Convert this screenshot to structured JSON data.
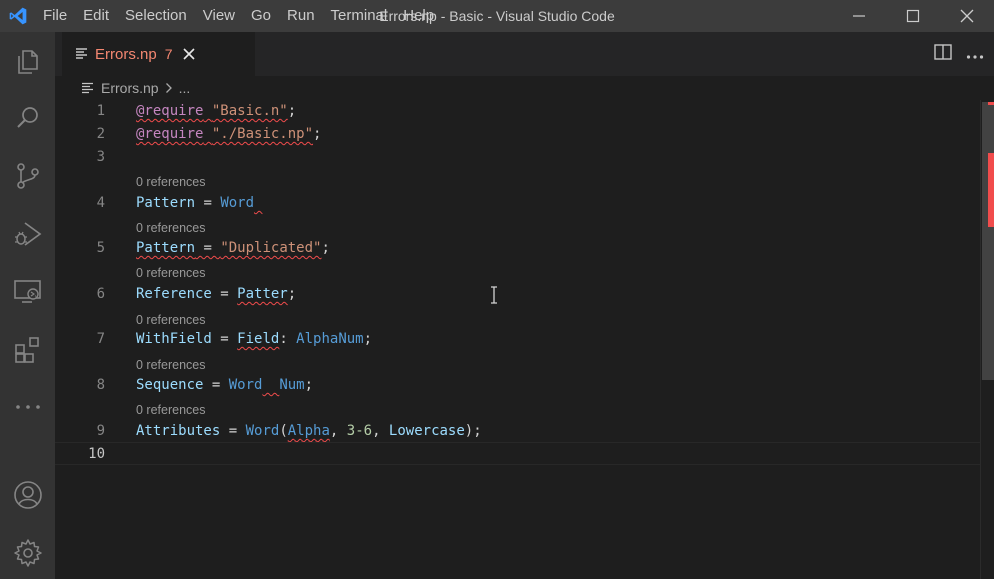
{
  "titlebar": {
    "menu": [
      "File",
      "Edit",
      "Selection",
      "View",
      "Go",
      "Run",
      "Terminal",
      "Help"
    ],
    "window_title": "Errors.np - Basic - Visual Studio Code",
    "accent": "#3c3c3c"
  },
  "activitybar": {
    "items": [
      "explorer-icon",
      "search-icon",
      "source-control-icon",
      "run-debug-icon",
      "remote-explorer-icon",
      "extensions-icon",
      "more-icon",
      "accounts-icon",
      "settings-gear-icon"
    ]
  },
  "tab": {
    "label": "Errors.np",
    "problem_count": "7",
    "error_color": "#f48771"
  },
  "breadcrumb": {
    "file": "Errors.np",
    "rest": "..."
  },
  "editor": {
    "code_lens": "0 references",
    "line_numbers": [
      "1",
      "2",
      "3",
      "4",
      "5",
      "6",
      "7",
      "8",
      "9",
      "10"
    ],
    "lines": [
      {
        "tokens": [
          {
            "t": "@require",
            "c": "kw"
          },
          {
            "t": " ",
            "c": "pl"
          },
          {
            "t": "\"Basic.n\"",
            "c": "str"
          },
          {
            "t": ";",
            "c": "pl"
          }
        ]
      },
      {
        "tokens": [
          {
            "t": "@require",
            "c": "kw"
          },
          {
            "t": " ",
            "c": "pl"
          },
          {
            "t": "\"./Basic.np\"",
            "c": "str"
          },
          {
            "t": ";",
            "c": "pl"
          }
        ]
      },
      {
        "tokens": []
      },
      {
        "tokens": [
          {
            "t": "Pattern",
            "c": "id"
          },
          {
            "t": " = ",
            "c": "pl"
          },
          {
            "t": "Word",
            "c": "fn"
          },
          {
            "t": " ",
            "c": "pl"
          }
        ]
      },
      {
        "tokens": [
          {
            "t": "Pattern",
            "c": "id"
          },
          {
            "t": " = ",
            "c": "pl"
          },
          {
            "t": "\"Duplicated\"",
            "c": "str"
          },
          {
            "t": ";",
            "c": "pl"
          }
        ]
      },
      {
        "tokens": [
          {
            "t": "Reference",
            "c": "id"
          },
          {
            "t": " = ",
            "c": "pl"
          },
          {
            "t": "Patter",
            "c": "id"
          },
          {
            "t": ";",
            "c": "pl"
          }
        ]
      },
      {
        "tokens": [
          {
            "t": "WithField",
            "c": "id"
          },
          {
            "t": " = ",
            "c": "pl"
          },
          {
            "t": "Field",
            "c": "id"
          },
          {
            "t": ": ",
            "c": "pl"
          },
          {
            "t": "AlphaNum",
            "c": "fn"
          },
          {
            "t": ";",
            "c": "pl"
          }
        ]
      },
      {
        "tokens": [
          {
            "t": "Sequence",
            "c": "id"
          },
          {
            "t": " = ",
            "c": "pl"
          },
          {
            "t": "Word",
            "c": "fn"
          },
          {
            "t": "  ",
            "c": "pl"
          },
          {
            "t": "Num",
            "c": "fn"
          },
          {
            "t": ";",
            "c": "pl"
          }
        ]
      },
      {
        "tokens": [
          {
            "t": "Attributes",
            "c": "id"
          },
          {
            "t": " = ",
            "c": "pl"
          },
          {
            "t": "Word",
            "c": "fn"
          },
          {
            "t": "(",
            "c": "pl"
          },
          {
            "t": "Alpha",
            "c": "fn"
          },
          {
            "t": ", ",
            "c": "pl"
          },
          {
            "t": "3-6",
            "c": "num"
          },
          {
            "t": ", ",
            "c": "pl"
          },
          {
            "t": "Lowercase",
            "c": "id"
          },
          {
            "t": ");",
            "c": "pl"
          }
        ]
      },
      {
        "tokens": []
      }
    ]
  }
}
